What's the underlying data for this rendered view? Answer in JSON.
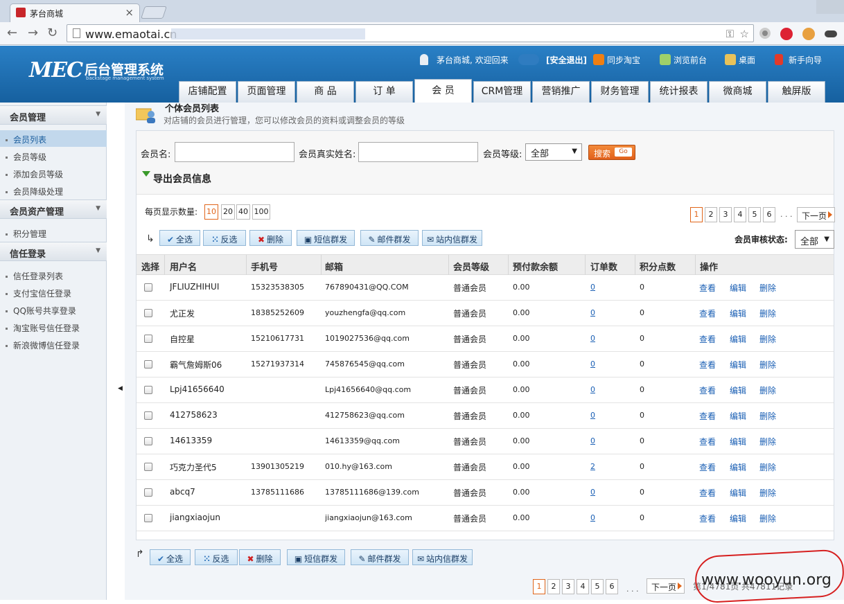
{
  "browser": {
    "tab_title": "茅台商城",
    "url": "www.emaotai.cn",
    "masked_url_color": "#c6d4ea"
  },
  "header": {
    "logo_main": "MEC",
    "logo_cn": "后台管理系统",
    "logo_sub": "backstage management system",
    "welcome": "茅台商城, 欢迎回来",
    "logout": "[安全退出]",
    "sync_taobao": "同步淘宝",
    "browse_front": "浏览前台",
    "desktop": "桌面",
    "guide": "新手向导",
    "nav_tabs": [
      "店铺配置",
      "页面管理",
      "商 品",
      "订 单",
      "会 员",
      "CRM管理",
      "营销推广",
      "财务管理",
      "统计报表",
      "微商城",
      "触屏版"
    ],
    "active_tab": "会 员"
  },
  "sidebar": {
    "groups": [
      {
        "title": "会员管理",
        "items": [
          "会员列表",
          "会员等级",
          "添加会员等级",
          "会员降级处理"
        ]
      },
      {
        "title": "会员资产管理",
        "items": [
          "积分管理"
        ]
      },
      {
        "title": "信任登录",
        "items": [
          "信任登录列表",
          "支付宝信任登录",
          "QQ账号共享登录",
          "淘宝账号信任登录",
          "新浪微博信任登录"
        ]
      }
    ],
    "active_item": "会员列表"
  },
  "page": {
    "title": "个体会员列表",
    "desc": "对店铺的会员进行管理，您可以修改会员的资料或调整会员的等级"
  },
  "search": {
    "member_name_label": "会员名:",
    "real_name_label": "会员真实姓名:",
    "level_label": "会员等级:",
    "level_value": "全部",
    "search_btn": "搜索",
    "go_label": "Go",
    "export_label": "导出会员信息"
  },
  "paging": {
    "per_page_label": "每页显示数量:",
    "per_page_options": [
      "10",
      "20",
      "40",
      "100"
    ],
    "per_page_selected": "10",
    "pages": [
      "1",
      "2",
      "3",
      "4",
      "5",
      "6"
    ],
    "current_page": "1",
    "dots": ". . .",
    "next_label": "下一页"
  },
  "actions": {
    "select_all": "全选",
    "invert": "反选",
    "delete": "删除",
    "sms": "短信群发",
    "email": "邮件群发",
    "site_msg": "站内信群发"
  },
  "audit": {
    "label": "会员审核状态:",
    "value": "全部"
  },
  "table": {
    "columns": [
      "选择",
      "用户名",
      "手机号",
      "邮箱",
      "会员等级",
      "预付款余额",
      "订单数",
      "积分点数",
      "操作"
    ],
    "rows": [
      {
        "user": "JFLIUZHIHUI",
        "phone": "15323538305",
        "email": "767890431@QQ.COM",
        "level": "普通会员",
        "balance": "0.00",
        "orders": "0",
        "points": "0"
      },
      {
        "user": "尤正发",
        "phone": "18385252609",
        "email": "youzhengfa@qq.com",
        "level": "普通会员",
        "balance": "0.00",
        "orders": "0",
        "points": "0"
      },
      {
        "user": "自控星",
        "phone": "15210617731",
        "email": "1019027536@qq.com",
        "level": "普通会员",
        "balance": "0.00",
        "orders": "0",
        "points": "0"
      },
      {
        "user": "霸气詹姆斯06",
        "phone": "15271937314",
        "email": "745876545@qq.com",
        "level": "普通会员",
        "balance": "0.00",
        "orders": "0",
        "points": "0"
      },
      {
        "user": "Lpj41656640",
        "phone": "",
        "email": "Lpj41656640@qq.com",
        "level": "普通会员",
        "balance": "0.00",
        "orders": "0",
        "points": "0"
      },
      {
        "user": "412758623",
        "phone": "",
        "email": "412758623@qq.com",
        "level": "普通会员",
        "balance": "0.00",
        "orders": "0",
        "points": "0"
      },
      {
        "user": "14613359",
        "phone": "",
        "email": "14613359@qq.com",
        "level": "普通会员",
        "balance": "0.00",
        "orders": "0",
        "points": "0"
      },
      {
        "user": "巧克力圣代5",
        "phone": "13901305219",
        "email": "010.hy@163.com",
        "level": "普通会员",
        "balance": "0.00",
        "orders": "2",
        "points": "0"
      },
      {
        "user": "abcq7",
        "phone": "13785111686",
        "email": "13785111686@139.com",
        "level": "普通会员",
        "balance": "0.00",
        "orders": "0",
        "points": "0"
      },
      {
        "user": "jiangxiaojun",
        "phone": "",
        "email": "jiangxiaojun@163.com",
        "level": "普通会员",
        "balance": "0.00",
        "orders": "0",
        "points": "0"
      }
    ],
    "op_view": "查看",
    "op_edit": "编辑",
    "op_delete": "删除"
  },
  "footer": {
    "records_text": "第1/4781页 共47811记录",
    "watermark": "www.wooyun.org"
  },
  "colors": {
    "accent": "#1a6ab3",
    "orange": "#e0651a",
    "link": "#1a5fb4",
    "annotation": "#d61f1f"
  }
}
